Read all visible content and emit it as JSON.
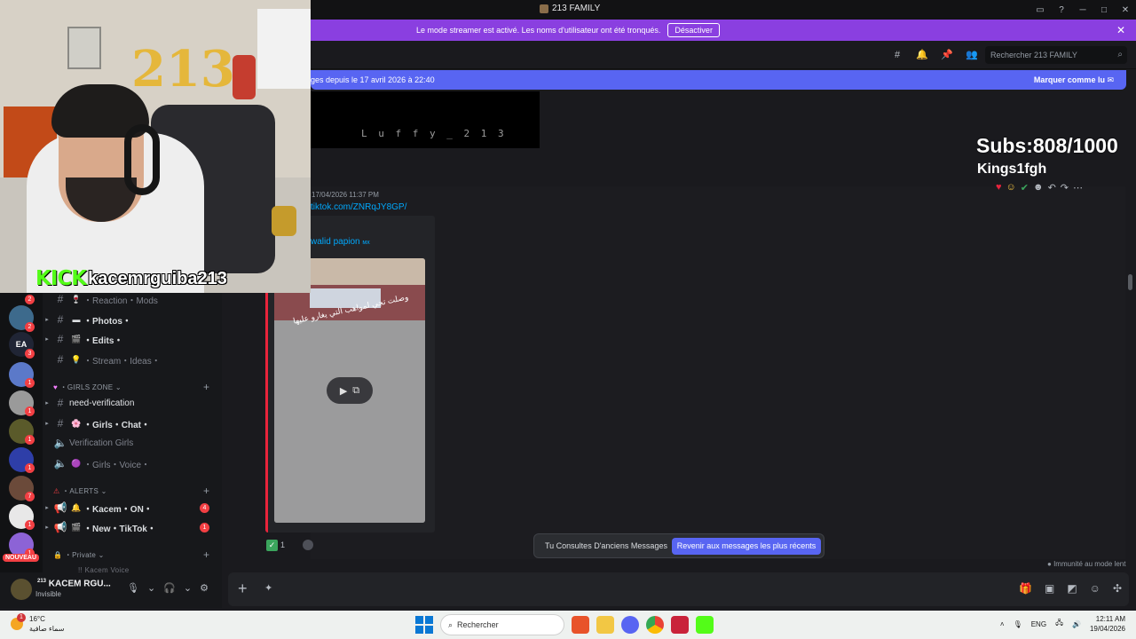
{
  "window": {
    "title": "213 FAMILY"
  },
  "streamer_banner": {
    "text": "Le mode streamer est activé. Les noms d'utilisateur ont été tronqués.",
    "button": "Désactiver"
  },
  "header": {
    "search_placeholder": "Rechercher 213 FAMILY"
  },
  "new_messages_bar": {
    "text": "ges depuis le 17 avril 2026 à 22:40",
    "action": "Marquer comme lu"
  },
  "pinned": {
    "luffy_text": "L u f f y _ 2 1 3"
  },
  "overlay": {
    "subs": "Subs:808/1000",
    "kings": "Kings1fgh",
    "kick_brand": "KICK",
    "kick_user": "kacemrguiba213"
  },
  "message": {
    "timestamp": "17/04/2026 11:37 PM",
    "link": "tiktok.com/ZNRqJY8GP/",
    "embed_author": "walid papion",
    "embed_author_suffix": "ᴍx",
    "video_caption": "وصلت تجي لمواهب التي يغارو عليها",
    "reaction_count": "1"
  },
  "old_messages": {
    "text": "Tu Consultes D'anciens Messages",
    "button": "Revenir aux messages les plus récents"
  },
  "immunity": "Immunité au mode lent",
  "channels": [
    {
      "type": "text",
      "emoji": "🍷",
      "label": "・Reaction・Mods",
      "muted": true
    },
    {
      "type": "text",
      "emoji": "▬",
      "label": "・Photos・",
      "muted": false
    },
    {
      "type": "text",
      "emoji": "🎬",
      "label": "・Edits・",
      "muted": false
    },
    {
      "type": "text",
      "emoji": "💡",
      "label": "・Stream・Ideas・",
      "muted": true
    }
  ],
  "categories": {
    "girls_zone": "・GIRLS ZONE",
    "alerts": "・ALERTS",
    "private": "・Private"
  },
  "girls_channels": [
    {
      "type": "text",
      "label": "need-verification",
      "plain": true
    },
    {
      "type": "text",
      "emoji": "🌸",
      "label": "・Girls・Chat・"
    },
    {
      "type": "voice",
      "label": "Verification Girls",
      "muted": true
    },
    {
      "type": "voice",
      "emoji": "🟣",
      "label": "・Girls・Voice・",
      "muted": true
    }
  ],
  "alert_channels": [
    {
      "type": "announce",
      "emoji": "🔔",
      "label": "・Kacem・ON・",
      "badge": "4"
    },
    {
      "type": "announce",
      "emoji": "🎬",
      "label": "・New・TikTok・",
      "badge": "1"
    }
  ],
  "private_peek": "!! Kacem Voice",
  "server_badges": [
    "2",
    "2",
    "3",
    "1",
    "1",
    "1",
    "1",
    "7",
    "1",
    "1"
  ],
  "nouveau_label": "NOUVEAU",
  "user": {
    "name": "KACEM RGU...",
    "tag": "213",
    "status": "Invisible"
  },
  "taskbar": {
    "temp": "16°C",
    "condition": "سماء صافية",
    "weather_badge": "1",
    "search": "Rechercher",
    "lang": "ENG",
    "time": "12:11 AM",
    "date": "19/04/2026"
  },
  "colors": {
    "accent": "#5865f2",
    "banner": "#8a3fe0",
    "kick_green": "#53fc18",
    "embed_border": "#e9243b"
  }
}
